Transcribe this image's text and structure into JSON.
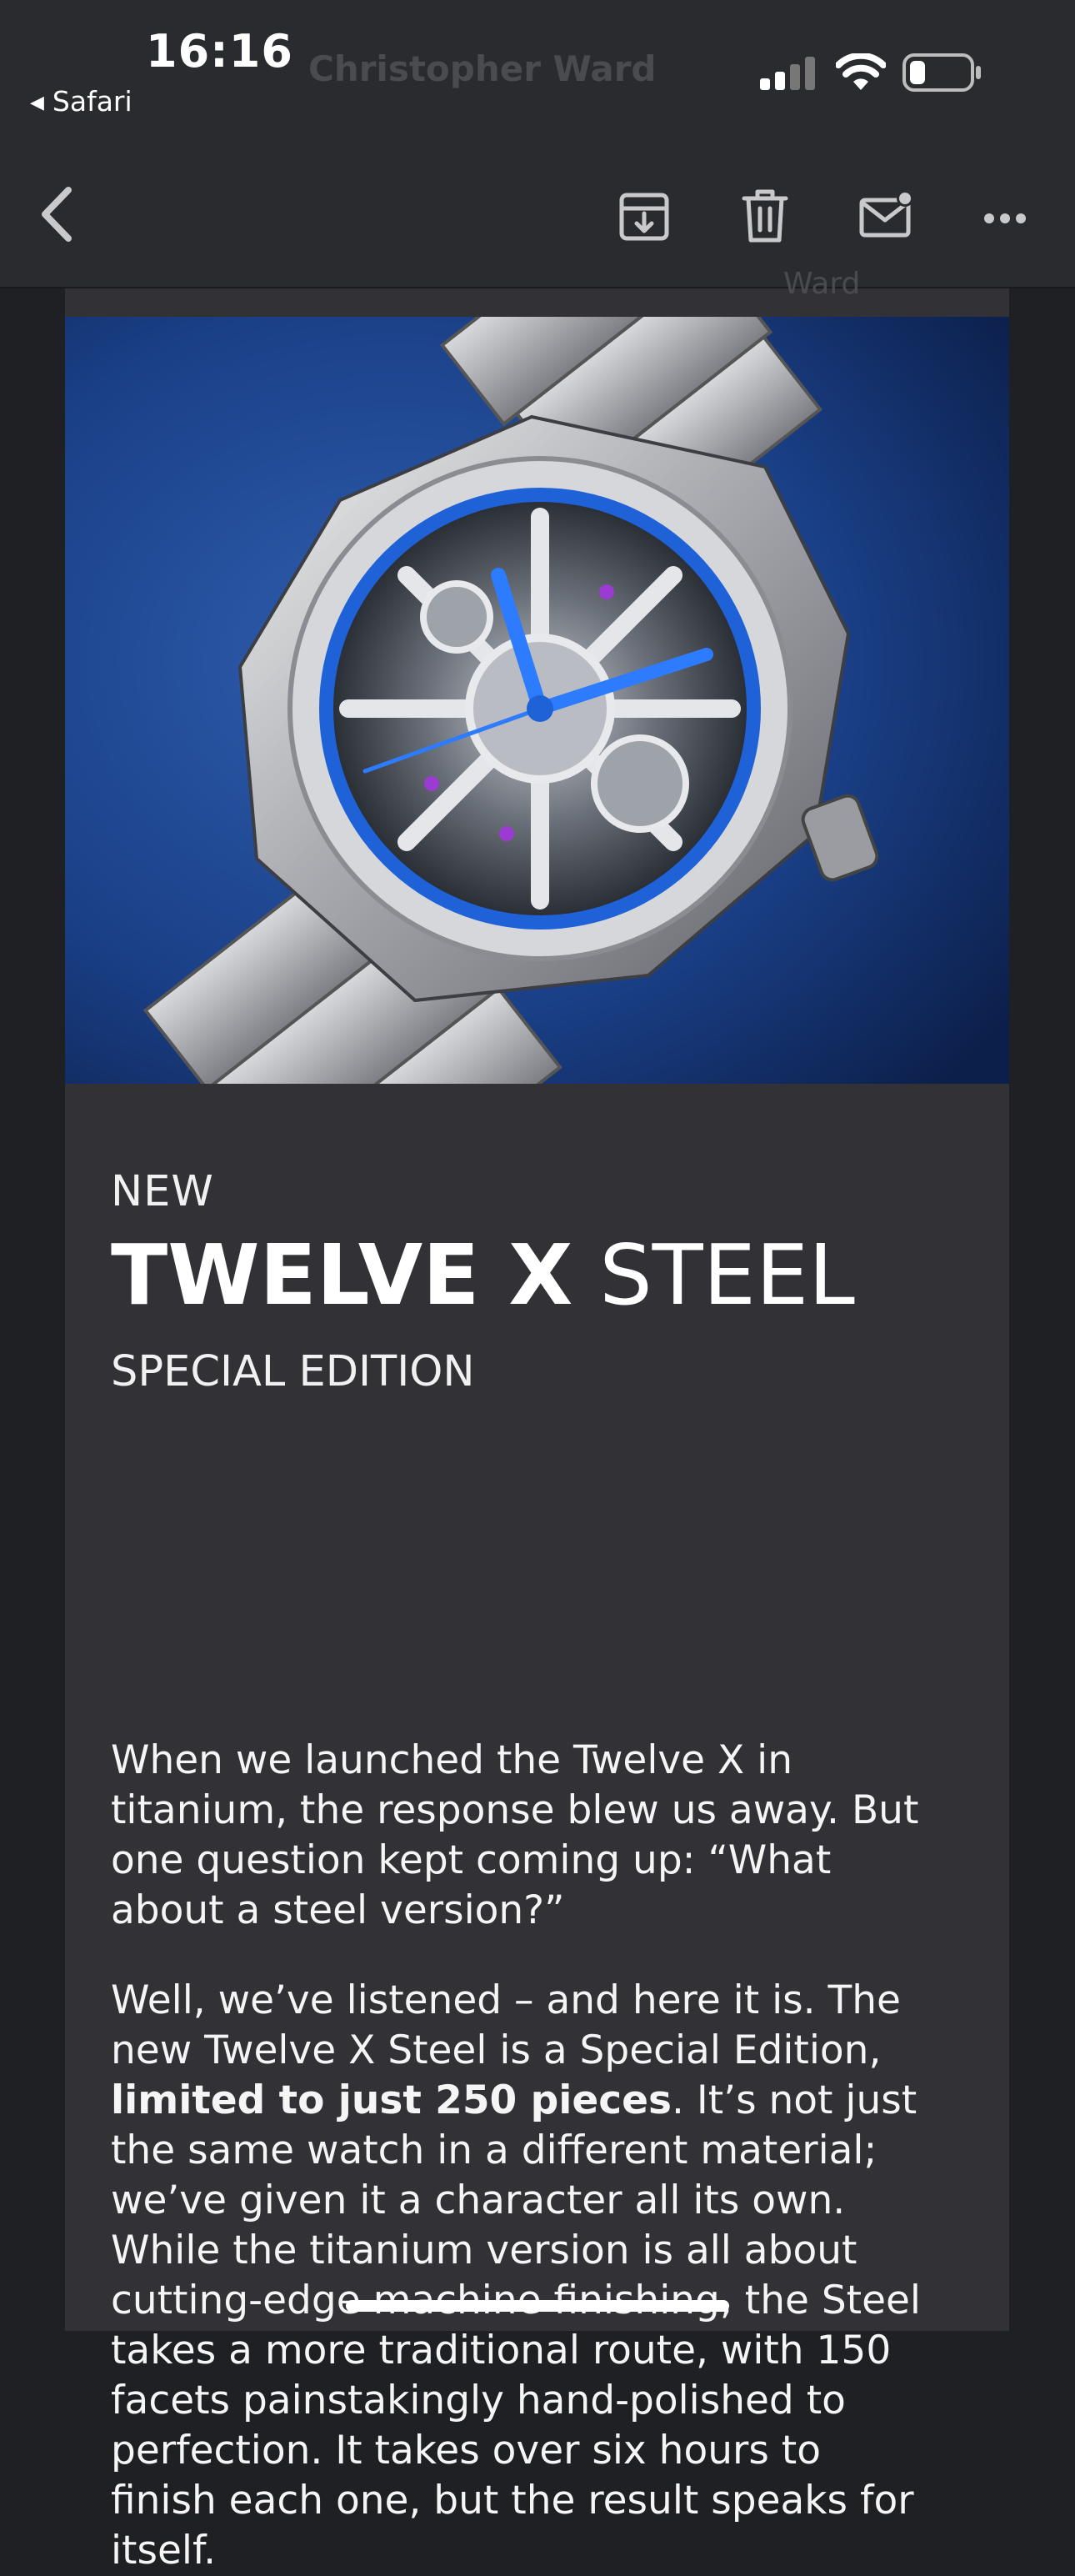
{
  "status_bar": {
    "time": "16:16",
    "back_app": "Safari"
  },
  "header": {
    "faded_sender": "Christopher Ward",
    "faded_ward": "Ward"
  },
  "toolbar": {
    "back_icon": "chevron-left-icon",
    "archive_icon": "archive-icon",
    "trash_icon": "trash-icon",
    "mail_icon": "mail-unread-icon",
    "more_icon": "more-icon"
  },
  "email": {
    "hero_image": "watch-photo",
    "eyebrow": "NEW",
    "title_bold": "TWELVE X",
    "title_light": " STEEL",
    "subtitle": "SPECIAL EDITION",
    "p1_lines": [
      "When we launched the Twelve X in",
      "titanium, the response blew us away. But",
      "one question kept coming up: “What",
      "about a steel version?”"
    ],
    "p2_line1": "Well, we’ve listened – and here it is. The",
    "p2_line2": "new Twelve X Steel is a Special Edition,",
    "p2_line3_bold": "limited to just 250 pieces",
    "p2_line3_rest": ". It’s not just",
    "p2_rest_lines": [
      "the same watch in a different material;",
      "we’ve given it a character all its own.",
      "While the titanium version is all about",
      "cutting-edge machine finishing, the Steel",
      "takes a more traditional route, with 150",
      "facets painstakingly hand-polished to",
      "perfection. It takes over six hours to",
      "finish each one, but the result speaks for",
      "itself."
    ]
  },
  "colors": {
    "background": "#1f2023",
    "header": "#2a2b2e",
    "card": "#323236",
    "accent_blue": "#1f62d8"
  }
}
